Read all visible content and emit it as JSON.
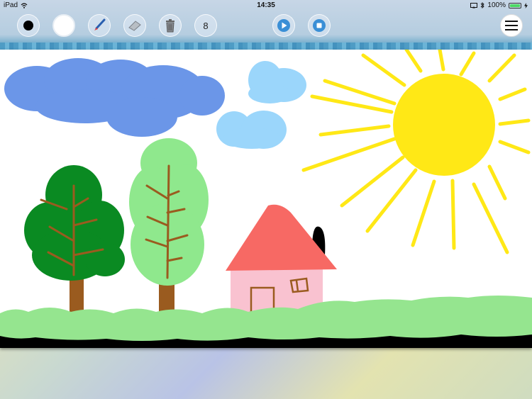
{
  "status_bar": {
    "device": "iPad",
    "time": "14:35",
    "battery": "100%",
    "battery_level": 1.0
  },
  "toolbar": {
    "tools": [
      {
        "name": "black-color-swatch",
        "icon": "black-dot"
      },
      {
        "name": "white-color-swatch",
        "icon": "white-circle"
      },
      {
        "name": "brush-tool",
        "icon": "brush-icon"
      },
      {
        "name": "eraser-tool",
        "icon": "eraser-icon"
      },
      {
        "name": "trash-tool",
        "icon": "trash-icon"
      }
    ],
    "brush_size": "8",
    "play_icon": "play-icon",
    "stop_icon": "stop-icon",
    "menu_icon": "hamburger-icon"
  },
  "colors": {
    "accent_blue": "#3a8fd6",
    "sky_cloud_dark": "#6b96e8",
    "sky_cloud_light": "#9bd6fb",
    "sun": "#ffe816",
    "tree_dark": "#0a8a22",
    "tree_light": "#8fe88d",
    "trunk": "#9a5b1f",
    "roof": "#f76964",
    "house": "#f9c2d0",
    "grass": "#95e58f",
    "ground": "#000000"
  }
}
